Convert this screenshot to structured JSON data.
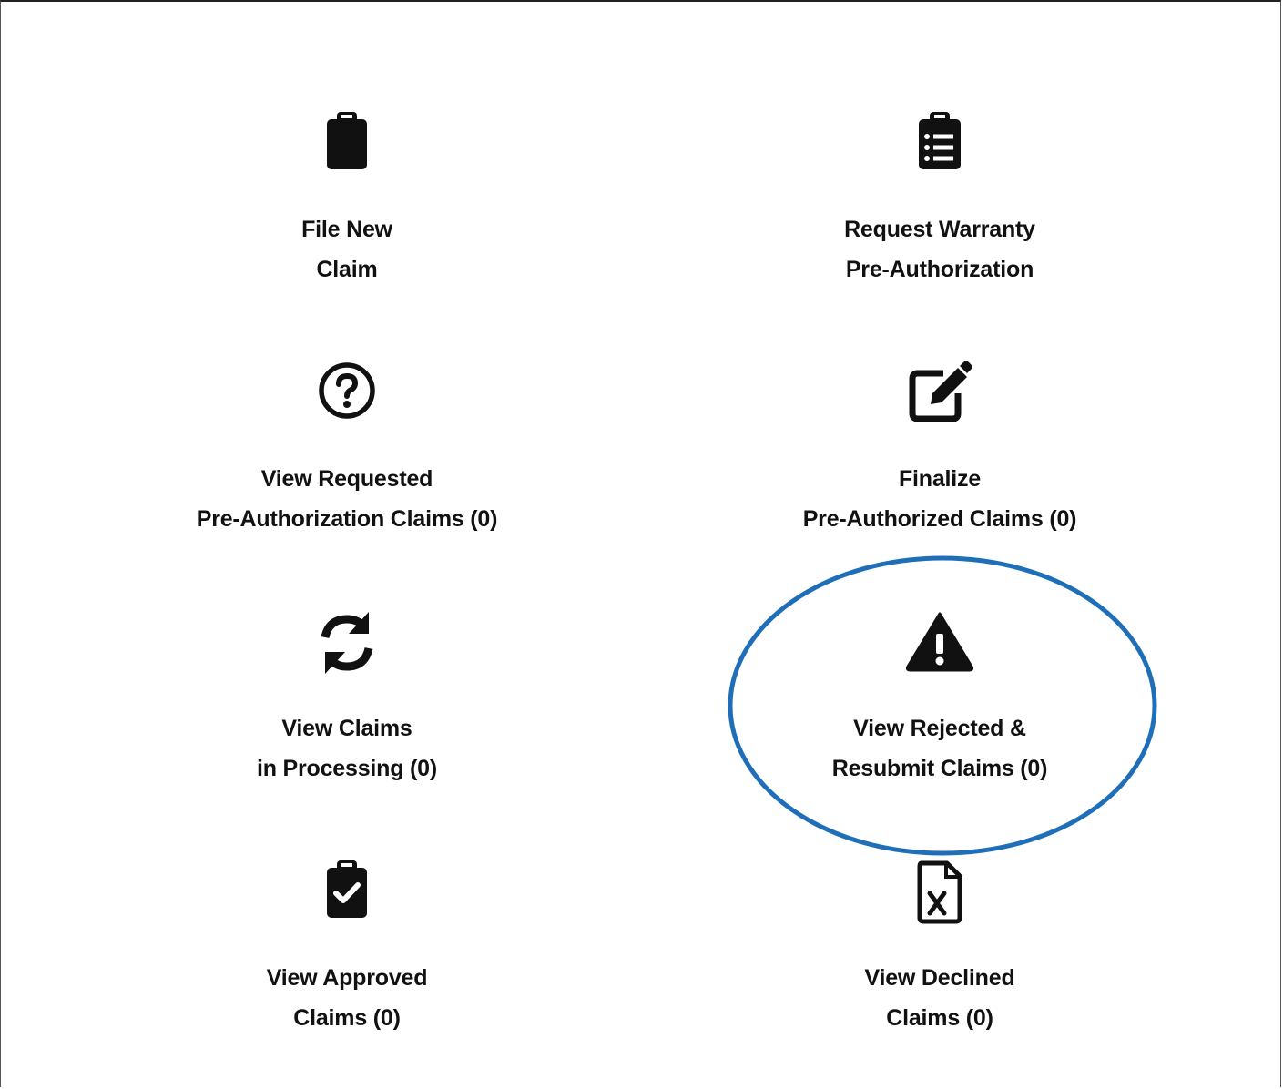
{
  "tiles": [
    {
      "id": "file-new-claim",
      "icon": "clipboard-icon",
      "line1": "File New",
      "line2": "Claim"
    },
    {
      "id": "request-warranty",
      "icon": "clipboard-list-icon",
      "line1": "Request Warranty",
      "line2": "Pre-Authorization"
    },
    {
      "id": "view-requested",
      "icon": "question-circle-icon",
      "line1": "View Requested",
      "line2": "Pre-Authorization Claims (0)"
    },
    {
      "id": "finalize",
      "icon": "edit-square-icon",
      "line1": "Finalize",
      "line2": "Pre-Authorized Claims (0)"
    },
    {
      "id": "in-processing",
      "icon": "sync-icon",
      "line1": "View Claims",
      "line2": "in Processing (0)"
    },
    {
      "id": "rejected",
      "icon": "warning-triangle-icon",
      "line1": "View Rejected &",
      "line2": "Resubmit Claims (0)"
    },
    {
      "id": "approved",
      "icon": "clipboard-check-icon",
      "line1": "View Approved",
      "line2": "Claims (0)"
    },
    {
      "id": "declined",
      "icon": "file-excel-icon",
      "line1": "View Declined",
      "line2": "Claims (0)"
    }
  ],
  "colors": {
    "text": "#111111",
    "highlight": "#1f6fb8"
  }
}
